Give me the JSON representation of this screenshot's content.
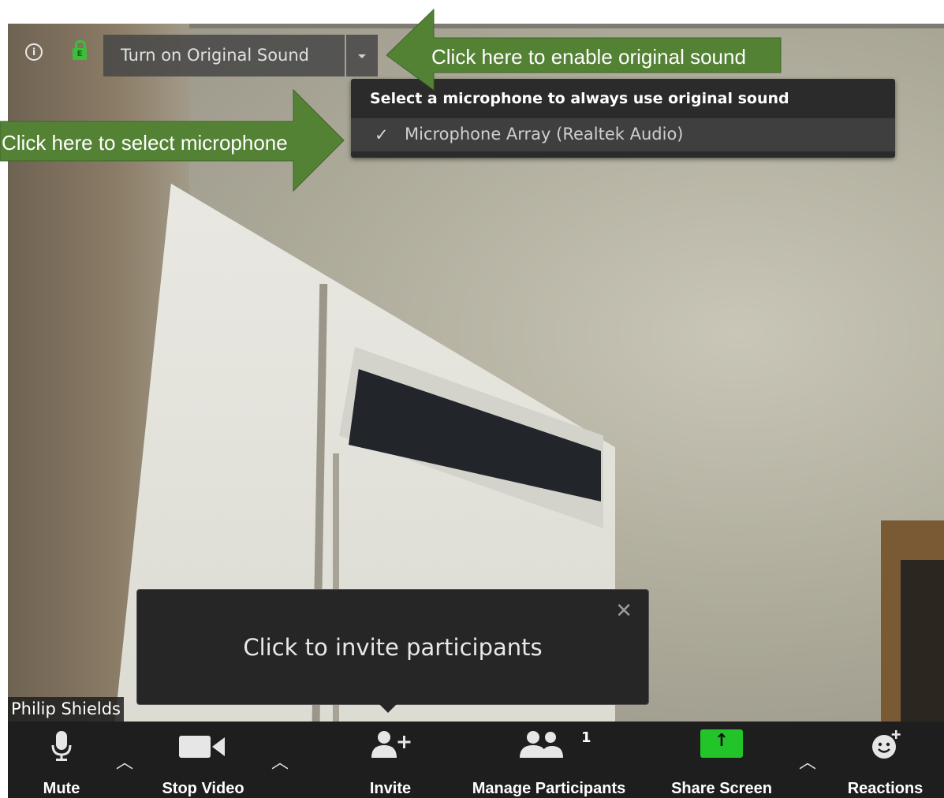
{
  "top_bar": {
    "info_icon": "info-icon",
    "lock_badge": "E",
    "original_sound_label": "Turn on Original Sound"
  },
  "mic_menu": {
    "title": "Select a microphone to always use original sound",
    "items": [
      {
        "label": "Microphone Array (Realtek Audio)",
        "checked": true,
        "check_glyph": "✓"
      }
    ]
  },
  "annotations": {
    "original_sound": "Click here to enable original sound",
    "select_microphone": "Click here to select microphone",
    "arrow_color": "#548235"
  },
  "tooltip": {
    "text": "Click to invite participants",
    "close_glyph": "✕"
  },
  "participant_name": "Philip Shields",
  "toolbar": {
    "mute_label": "Mute",
    "stop_video_label": "Stop Video",
    "invite_label": "Invite",
    "manage_participants_label": "Manage Participants",
    "participant_count": "1",
    "share_screen_label": "Share Screen",
    "reactions_label": "Reactions",
    "chevron_glyph": "︿",
    "share_color": "#22c42a"
  }
}
